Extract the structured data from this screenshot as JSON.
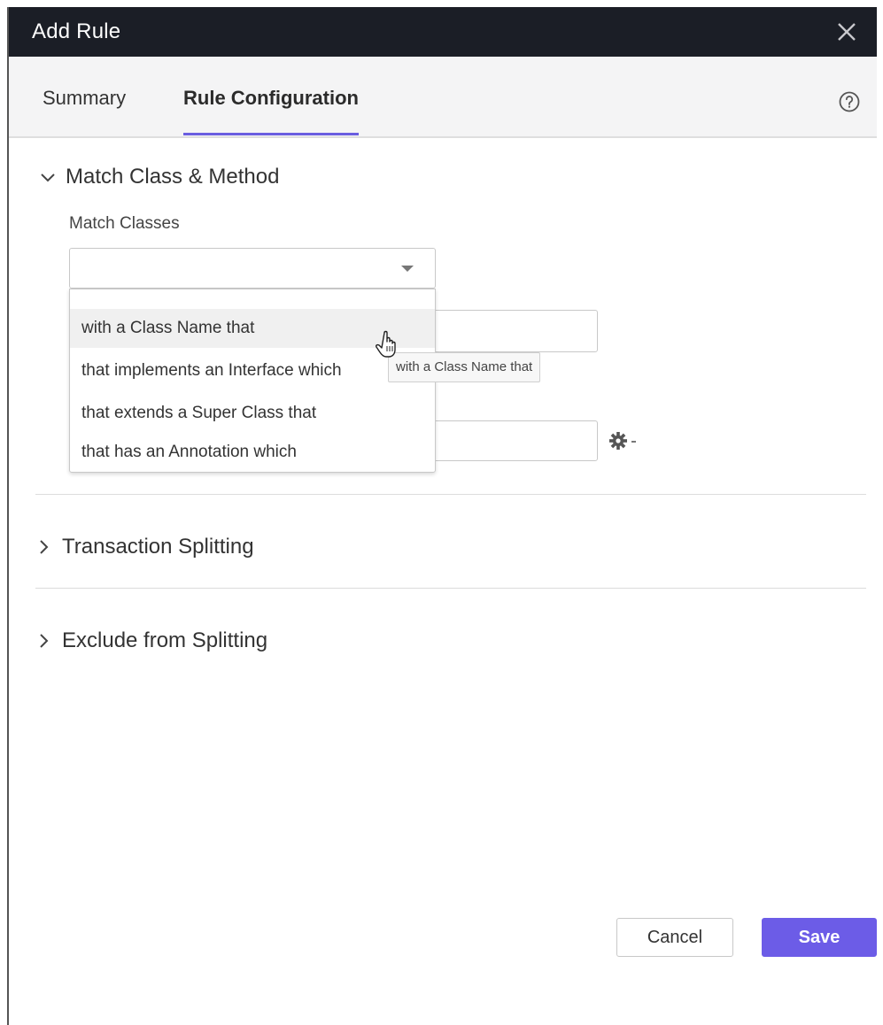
{
  "dialog": {
    "title": "Add Rule",
    "close_icon": "close-icon"
  },
  "tabs": [
    {
      "label": "Summary",
      "active": false
    },
    {
      "label": "Rule Configuration",
      "active": true
    }
  ],
  "help_icon": "help-circle-icon",
  "accent_color": "#6a5ee0",
  "sections": {
    "match": {
      "label": "Match Class & Method",
      "expanded": true
    },
    "transaction_splitting": {
      "label": "Transaction Splitting",
      "expanded": false
    },
    "exclude_from_splitting": {
      "label": "Exclude from Splitting",
      "expanded": false
    }
  },
  "match_classes": {
    "label": "Match Classes",
    "selected_value": "",
    "options": [
      "with a Class Name that",
      "that implements an Interface which",
      "that extends a Super Class that",
      "that has an Annotation which"
    ],
    "highlighted_index": 0
  },
  "tooltip": "with a Class Name that",
  "gear_icon": "gear-dropdown-icon",
  "footer": {
    "cancel_label": "Cancel",
    "save_label": "Save"
  }
}
